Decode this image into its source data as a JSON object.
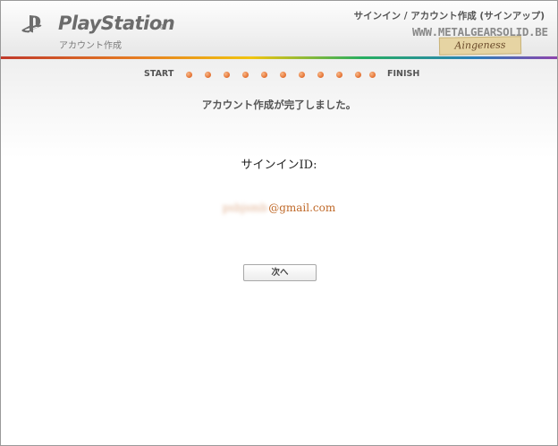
{
  "header": {
    "brand": "PlayStation",
    "registered_mark": "®",
    "subtitle": "アカウント作成",
    "right_title": "サインイン / アカウント作成 (サインアップ)",
    "watermark": "WWW.METALGEARSOLID.BE",
    "watermark_sign": "Aingeness"
  },
  "progress": {
    "start_label": "START",
    "finish_label": "FINISH",
    "steps": 11,
    "dot_color": "#e8793a"
  },
  "main": {
    "title": "アカウント作成が完了しました。",
    "signin_label": "サインインID:",
    "email_user": "psbjsmb",
    "email_domain": "@gmail.com",
    "next_button": "次へ"
  },
  "colors": {
    "email": "#c06a2a",
    "accent_dots": "#e8793a"
  }
}
